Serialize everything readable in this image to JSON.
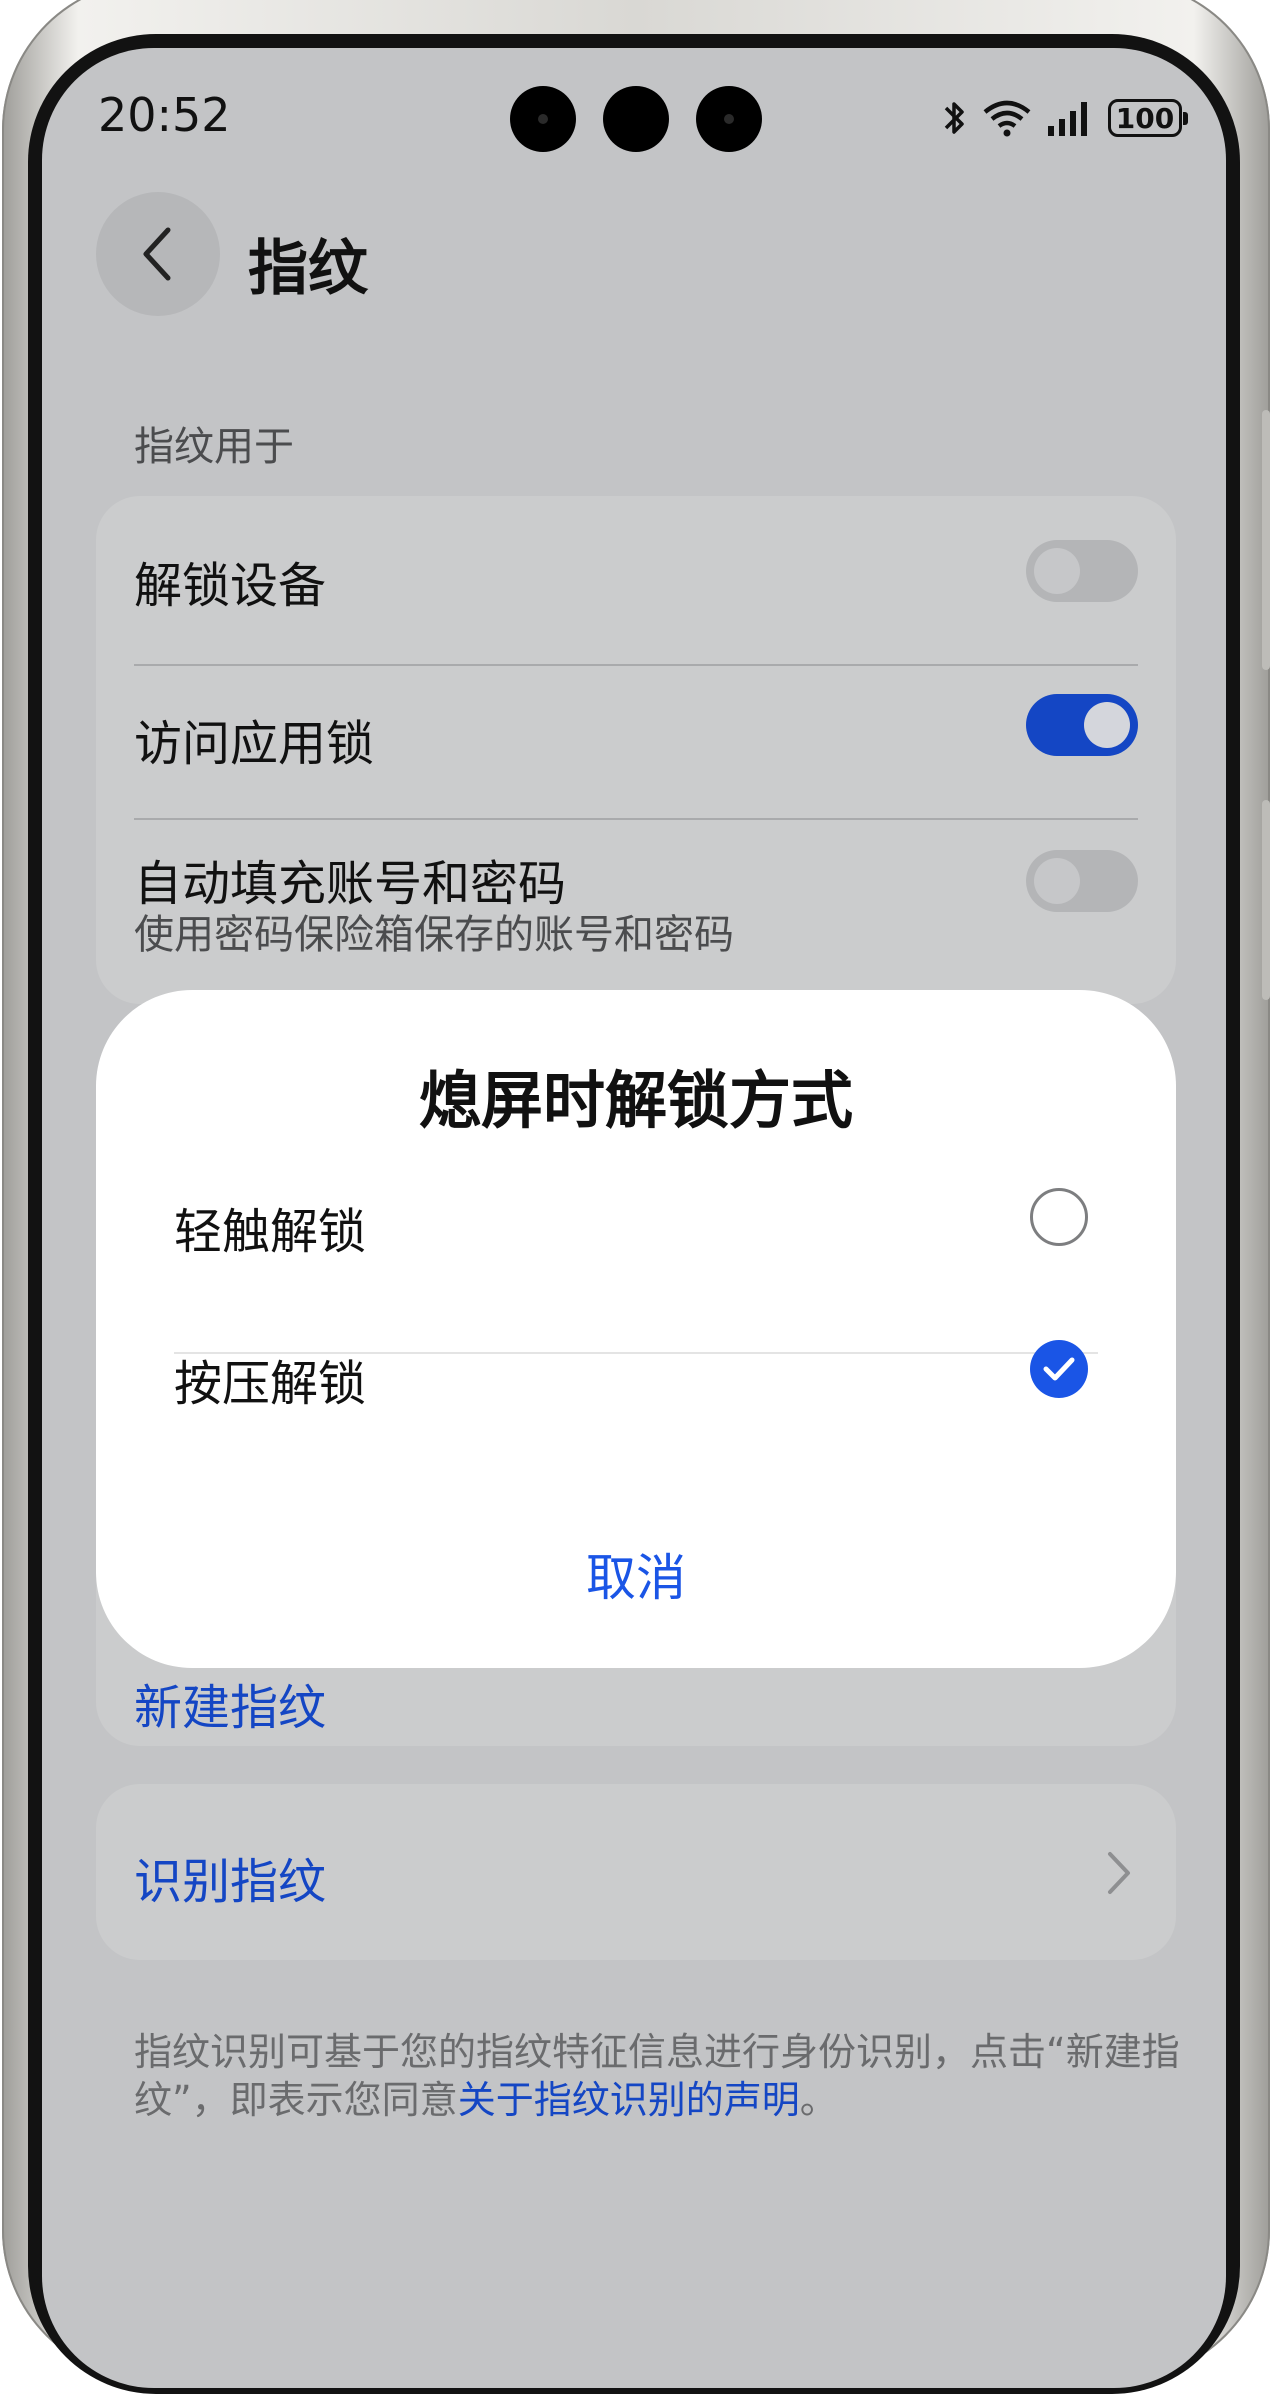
{
  "status_bar": {
    "time": "20:52",
    "battery": "100"
  },
  "header": {
    "title": "指纹"
  },
  "section": {
    "label": "指纹用于"
  },
  "settings": [
    {
      "title": "解锁设备",
      "toggle": false
    },
    {
      "title": "访问应用锁",
      "toggle": true
    },
    {
      "title": "自动填充账号和密码",
      "subtitle": "使用密码保险箱保存的账号和密码",
      "toggle": false
    }
  ],
  "new_fingerprint": {
    "label": "新建指纹"
  },
  "identify_fingerprint": {
    "label": "识别指纹"
  },
  "footer": {
    "text": "指纹识别可基于您的指纹特征信息进行身份识别，点击“新建指纹”，即表示您同意",
    "link": "关于指纹识别的声明",
    "end": "。"
  },
  "dialog": {
    "title": "熄屏时解锁方式",
    "options": [
      {
        "label": "轻触解锁",
        "selected": false
      },
      {
        "label": "按压解锁",
        "selected": true
      }
    ],
    "cancel": "取消"
  },
  "colors": {
    "accent": "#1446c4",
    "dialog_accent": "#1a55e6",
    "dim_background": "#c3c4c6"
  }
}
